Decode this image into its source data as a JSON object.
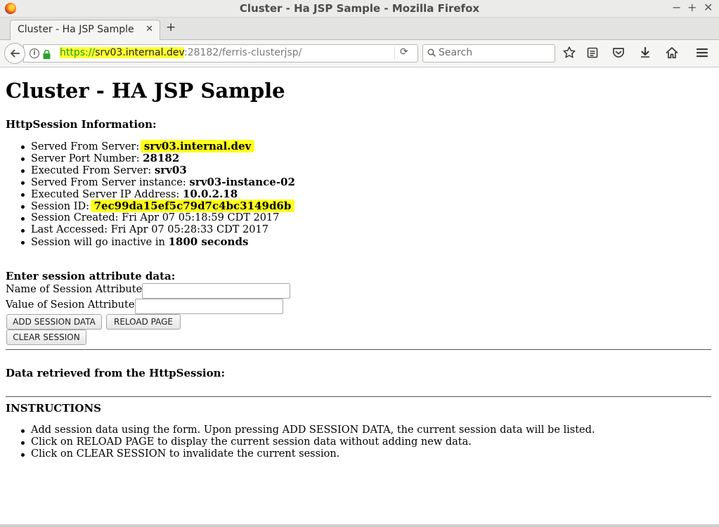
{
  "window": {
    "title": "Cluster - Ha JSP Sample - Mozilla Firefox"
  },
  "tab": {
    "label": "Cluster - Ha JSP Sample"
  },
  "nav": {
    "url_scheme": "https://",
    "url_host": "srv03.internal.dev",
    "url_rest": ":28182/ferris-clusterjsp/",
    "search_placeholder": "Search"
  },
  "page": {
    "title": "Cluster - HA JSP Sample",
    "session_heading": "HttpSession Information:",
    "session_info": [
      {
        "label": "Served From Server: ",
        "value": "srv03.internal.dev",
        "suffix": ""
      },
      {
        "label": "Server Port Number: ",
        "value": "28182",
        "suffix": ""
      },
      {
        "label": "Executed From Server: ",
        "value": "srv03",
        "suffix": ""
      },
      {
        "label": "Served From Server instance: ",
        "value": "srv03-instance-02",
        "suffix": ""
      },
      {
        "label": "Executed Server IP Address: ",
        "value": "10.0.2.18",
        "suffix": ""
      },
      {
        "label": "Session ID: ",
        "value": "7ec99da15ef5c79d7c4bc3149d6b",
        "suffix": ""
      },
      {
        "label": "Session Created: ",
        "value": "",
        "suffix": "Fri Apr 07 05:18:59 CDT 2017"
      },
      {
        "label": "Last Accessed: ",
        "value": "",
        "suffix": "Fri Apr 07 05:28:33 CDT 2017"
      },
      {
        "label": "Session will go inactive in ",
        "value": "1800 seconds",
        "suffix": ""
      }
    ],
    "form": {
      "heading": "Enter session attribute data:",
      "name_label": "Name of Session Attribute:",
      "name_value": "",
      "value_label": "Value of Sesion Attribute:",
      "value_value": "",
      "add_button": "ADD SESSION DATA",
      "reload_button": "RELOAD PAGE",
      "clear_button": "CLEAR SESSION"
    },
    "retrieved_heading": "Data retrieved from the HttpSession:",
    "instructions_heading": "INSTRUCTIONS",
    "instructions": [
      "Add session data using the form. Upon pressing ADD SESSION DATA, the current session data will be listed.",
      "Click on RELOAD PAGE to display the current session data without adding new data.",
      "Click on CLEAR SESSION to invalidate the current session."
    ]
  },
  "highlights": {
    "color": "#ffff1f"
  }
}
